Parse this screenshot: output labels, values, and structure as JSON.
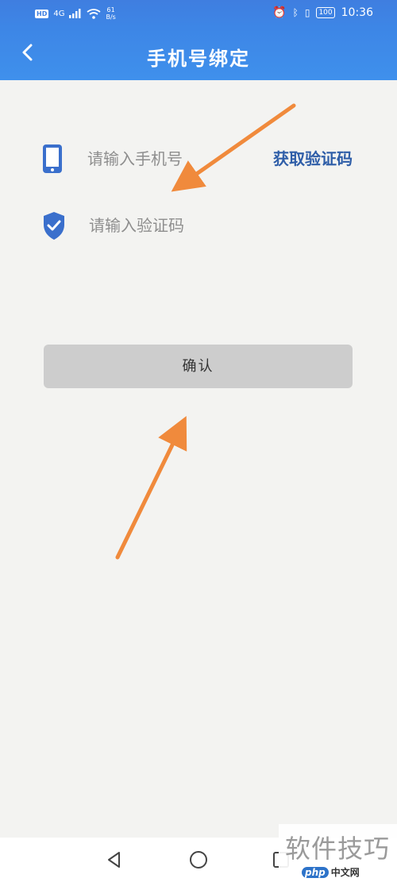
{
  "status_bar": {
    "network": "4G",
    "speed_value": "61",
    "speed_unit": "B/s",
    "battery": "100",
    "time": "10:36"
  },
  "header": {
    "title": "手机号绑定"
  },
  "form": {
    "phone_placeholder": "请输入手机号",
    "code_placeholder": "请输入验证码",
    "get_code_label": "获取验证码",
    "confirm_label": "确认"
  },
  "watermark": {
    "text": "软件技巧",
    "logo_php": "php",
    "logo_cn": "中文网"
  },
  "colors": {
    "header": "#3f86e6",
    "link": "#2f5ea8",
    "icon": "#3a6fcc",
    "arrow": "#f08a3c"
  },
  "icons": [
    "back-arrow-icon",
    "phone-icon",
    "shield-check-icon",
    "nav-back-icon",
    "nav-home-icon",
    "nav-recents-icon"
  ]
}
